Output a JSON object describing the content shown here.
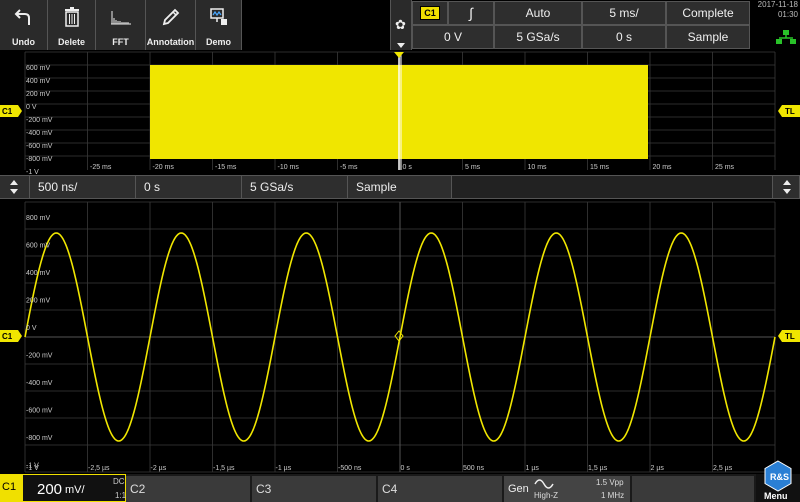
{
  "toolbar": {
    "undo": "Undo",
    "delete": "Delete",
    "fft": "FFT",
    "annotation": "Annotation",
    "demo": "Demo"
  },
  "trigger": {
    "source": "C1",
    "slope_symbol": "∫",
    "level": "0 V",
    "mode": "Auto",
    "time_base": "5 ms/",
    "sample_rate": "5 GSa/s",
    "position": "0 s",
    "state": "Complete",
    "acquisition": "Sample"
  },
  "datetime": {
    "date": "2017-11-18",
    "time": "01:30"
  },
  "overview": {
    "ch_marker": "C1",
    "tl_marker": "TL",
    "y_labels": [
      "600 mV",
      "400 mV",
      "200 mV",
      "0 V",
      "-200 mV",
      "-400 mV",
      "-600 mV",
      "-800 mV",
      "-1 V"
    ],
    "x_labels": [
      "-25 ms",
      "-20 ms",
      "-15 ms",
      "-10 ms",
      "-5 ms",
      "0 s",
      "5 ms",
      "10 ms",
      "15 ms",
      "20 ms",
      "25 ms"
    ]
  },
  "zoom": {
    "time_base": "500 ns/",
    "position": "0 s",
    "sample_rate": "5 GSa/s",
    "acquisition": "Sample"
  },
  "main": {
    "ch_marker": "C1",
    "tl_marker": "TL",
    "y_labels": [
      "800 mV",
      "600 mV",
      "400 mV",
      "200 mV",
      "0 V",
      "-200 mV",
      "-400 mV",
      "-600 mV",
      "-800 mV",
      "-1 V"
    ],
    "x_labels": [
      "-2,5 µs",
      "-2 µs",
      "-1,5 µs",
      "-1 µs",
      "-500 ns",
      "0 s",
      "500 ns",
      "1 µs",
      "1,5 µs",
      "2 µs",
      "2,5 µs"
    ]
  },
  "bottom": {
    "c1": "C1",
    "c1_scale": "200",
    "c1_unit": "mV/",
    "c1_coupling": "DC",
    "c1_ratio": "1:1",
    "c2": "C2",
    "c3": "C3",
    "c4": "C4",
    "gen": "Gen",
    "gen_load": "High-Z",
    "gen_amplitude": "1.5 Vpp",
    "gen_frequency": "1 MHz",
    "menu": "Menu",
    "logo": "R&S"
  },
  "colors": {
    "trace": "#f0e600",
    "grid": "#3a3a3a",
    "accent": "#f0e000"
  },
  "icons": [
    "undo-icon",
    "trash-icon",
    "fft-icon",
    "pencil-icon",
    "demo-icon",
    "gear-icon",
    "network-icon",
    "sine-icon"
  ]
}
